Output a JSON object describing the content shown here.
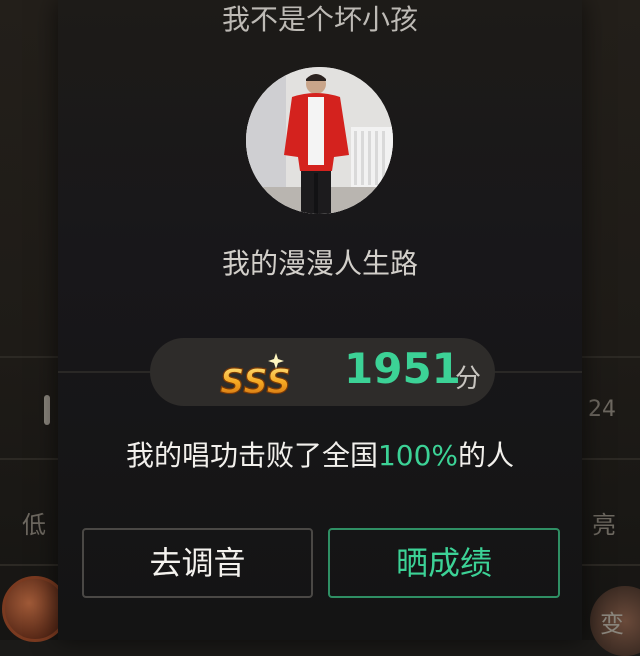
{
  "background": {
    "left_label_1": "低",
    "right_label_1": "亮",
    "right_number": "24",
    "right_label_2": "变"
  },
  "modal": {
    "title": "我不是个坏小孩",
    "song_name": "我的漫漫人生路",
    "grade": "SSS",
    "score": "1951",
    "score_unit": "分",
    "beat_text_prefix": "我的唱功击败了全国",
    "beat_percent": "100%",
    "beat_text_suffix": "的人",
    "buttons": {
      "tune": "去调音",
      "share": "晒成绩"
    }
  },
  "colors": {
    "accent": "#3cd296",
    "modal_bg": "#1a1918",
    "button_border": "#4a4845"
  }
}
